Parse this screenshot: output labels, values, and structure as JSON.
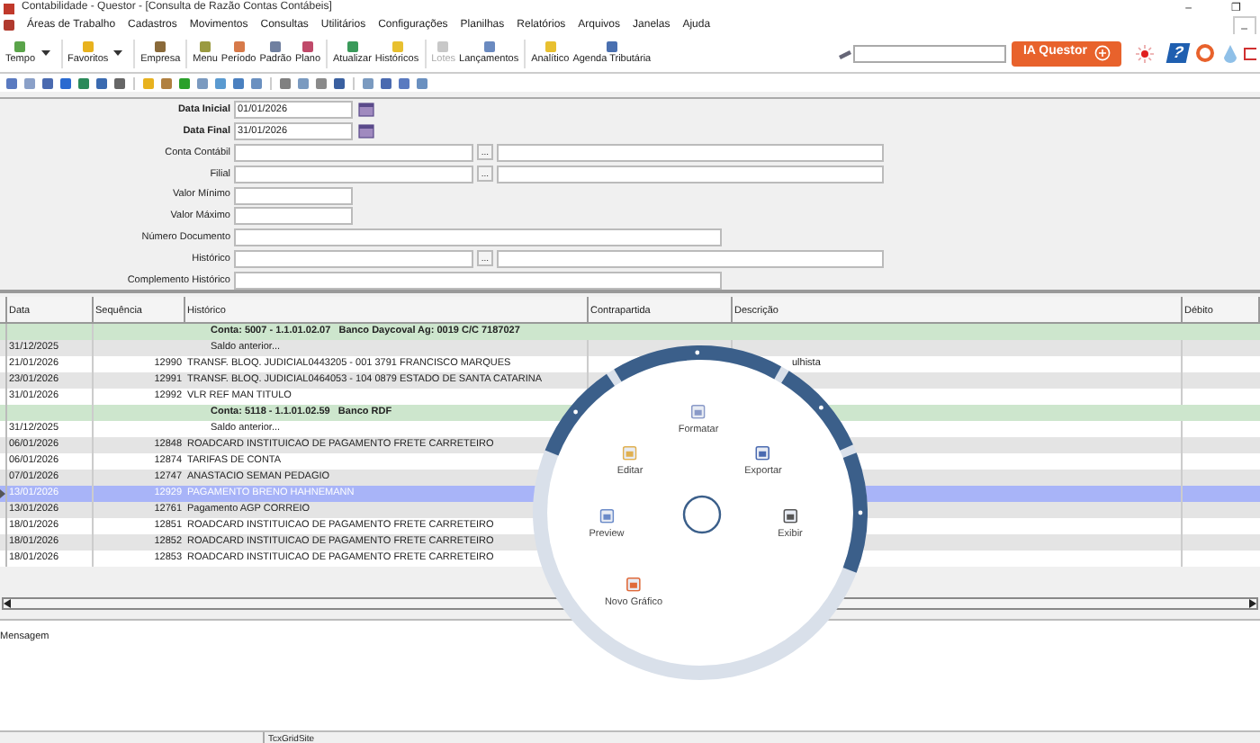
{
  "window": {
    "title": "Contabilidade - Questor - [Consulta de Razão Contas Contábeis]",
    "controls": [
      "–",
      "❐"
    ],
    "mdi_controls": [
      "_"
    ]
  },
  "menu": [
    "Áreas de Trabalho",
    "Cadastros",
    "Movimentos",
    "Consultas",
    "Utilitários",
    "Configurações",
    "Planilhas",
    "Relatórios",
    "Arquivos",
    "Janelas",
    "Ajuda"
  ],
  "toolbar": [
    {
      "label": "Tempo",
      "disabled": false,
      "dropdown": true
    },
    {
      "label": "Favoritos",
      "disabled": false,
      "dropdown": true
    },
    {
      "label": "Empresa",
      "disabled": false,
      "dropdown": false
    },
    {
      "label": "Menu",
      "disabled": false,
      "dropdown": false
    },
    {
      "label": "Período",
      "disabled": false,
      "dropdown": false
    },
    {
      "label": "Padrão",
      "disabled": false,
      "dropdown": false
    },
    {
      "label": "Plano",
      "disabled": false,
      "dropdown": false
    },
    {
      "label": "Atualizar",
      "disabled": false,
      "dropdown": false
    },
    {
      "label": "Históricos",
      "disabled": false,
      "dropdown": false
    },
    {
      "label": "Lotes",
      "disabled": true,
      "dropdown": false
    },
    {
      "label": "Lançamentos",
      "disabled": false,
      "dropdown": false
    },
    {
      "label": "Analítico",
      "disabled": false,
      "dropdown": false
    },
    {
      "label": "Agenda Tributária",
      "disabled": false,
      "dropdown": false
    }
  ],
  "ia_button": {
    "label": "IA Questor"
  },
  "help_icon": "?",
  "form": [
    {
      "label": "Data Inicial",
      "value": "01/01/2026",
      "kind": "date"
    },
    {
      "label": "Data Final",
      "value": "31/01/2026",
      "kind": "date"
    },
    {
      "label": "Conta Contábil",
      "kind": "lookup"
    },
    {
      "label": "Filial",
      "kind": "lookup"
    },
    {
      "label": "Valor Mínimo",
      "kind": "short"
    },
    {
      "label": "Valor Máximo",
      "kind": "short"
    },
    {
      "label": "Número Documento",
      "kind": "long"
    },
    {
      "label": "Histórico",
      "kind": "lookup"
    },
    {
      "label": "Complemento Histórico",
      "kind": "long"
    }
  ],
  "lookup_button": "...",
  "table": {
    "columns": [
      "Data",
      "Sequência",
      "Histórico",
      "Contrapartida",
      "Descrição",
      "Débito"
    ],
    "rows": [
      {
        "kind": "account",
        "text": "Conta: 5007 - 1.1.01.02.07   Banco Daycoval Ag: 0019 C/C 7187027",
        "selected": false
      },
      {
        "kind": "entry",
        "data": "31/12/2025",
        "historico": "Saldo anterior...",
        "selected": false
      },
      {
        "kind": "entry",
        "data": "21/01/2026",
        "sequencia": "12990",
        "historico": "TRANSF. BLOQ. JUDICIAL0443205 - 001 3791 FRANCISCO MARQUES",
        "descricao": "ulhista",
        "selected": false
      },
      {
        "kind": "entry",
        "data": "23/01/2026",
        "sequencia": "12991",
        "historico": "TRANSF. BLOQ. JUDICIAL0464053 - 104 0879 ESTADO DE SANTA CATARINA",
        "selected": false
      },
      {
        "kind": "entry",
        "data": "31/01/2026",
        "sequencia": "12992",
        "historico": "VLR REF MAN TITULO",
        "selected": false
      },
      {
        "kind": "account",
        "text": "Conta: 5118 - 1.1.01.02.59   Banco RDF",
        "selected": false
      },
      {
        "kind": "entry",
        "data": "31/12/2025",
        "historico": "Saldo anterior...",
        "selected": false
      },
      {
        "kind": "entry",
        "data": "06/01/2026",
        "sequencia": "12848",
        "historico": "ROADCARD INSTITUICAO DE PAGAMENTO FRETE CARRETEIRO",
        "selected": false
      },
      {
        "kind": "entry",
        "data": "06/01/2026",
        "sequencia": "12874",
        "historico": "TARIFAS DE CONTA",
        "selected": false
      },
      {
        "kind": "entry",
        "data": "07/01/2026",
        "sequencia": "12747",
        "historico": "ANASTACIO SEMAN PEDAGIO",
        "selected": false
      },
      {
        "kind": "entry",
        "data": "13/01/2026",
        "sequencia": "12929",
        "historico": "PAGAMENTO BRENO HAHNEMANN",
        "selected": true
      },
      {
        "kind": "entry",
        "data": "13/01/2026",
        "sequencia": "12761",
        "historico": "Pagamento AGP CORREIO",
        "selected": false
      },
      {
        "kind": "entry",
        "data": "18/01/2026",
        "sequencia": "12851",
        "historico": "ROADCARD INSTITUICAO DE PAGAMENTO FRETE CARRETEIRO",
        "selected": false
      },
      {
        "kind": "entry",
        "data": "18/01/2026",
        "sequencia": "12852",
        "historico": "ROADCARD INSTITUICAO DE PAGAMENTO FRETE CARRETEIRO",
        "selected": false
      },
      {
        "kind": "entry",
        "data": "18/01/2026",
        "sequencia": "12853",
        "historico": "ROADCARD INSTITUICAO DE PAGAMENTO FRETE CARRETEIRO",
        "selected": false
      }
    ]
  },
  "radial_menu": {
    "items": [
      "Formatar",
      "Editar",
      "Exportar",
      "Preview",
      "Exibir",
      "Novo Gráfico"
    ]
  },
  "messages": {
    "title": "Mensagem"
  },
  "status_bar": [
    "TcxGridSite"
  ]
}
